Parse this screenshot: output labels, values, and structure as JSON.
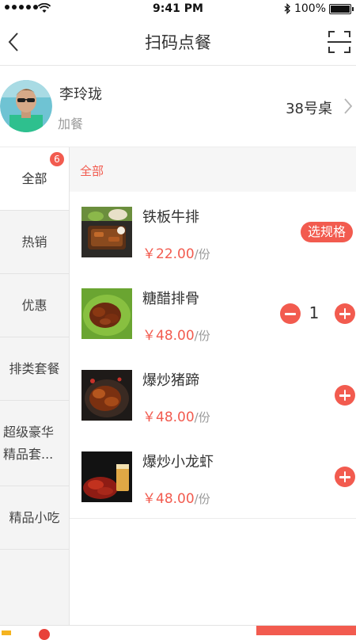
{
  "status": {
    "time": "9:41 PM",
    "battery": "100%"
  },
  "nav": {
    "title": "扫码点餐",
    "back_icon": "chevron-left-icon",
    "scan_icon": "scan-icon"
  },
  "user": {
    "name": "李玲珑",
    "tag": "加餐",
    "table": "38号桌"
  },
  "sidebar": {
    "items": [
      {
        "label": "全部",
        "badge": "6",
        "active": true
      },
      {
        "label": "热销"
      },
      {
        "label": "优惠"
      },
      {
        "label": "排类套餐"
      },
      {
        "label": "超级豪华精品套..."
      },
      {
        "label": "精品小吃"
      }
    ]
  },
  "content": {
    "category_title": "全部",
    "dishes": [
      {
        "name": "铁板牛排",
        "price": "￥22.00",
        "unit": "/份",
        "action": "选规格"
      },
      {
        "name": "糖醋排骨",
        "price": "￥48.00",
        "unit": "/份",
        "quantity": "1"
      },
      {
        "name": "爆炒猪蹄",
        "price": "￥48.00",
        "unit": "/份"
      },
      {
        "name": "爆炒小龙虾",
        "price": "￥48.00",
        "unit": "/份"
      }
    ]
  },
  "colors": {
    "accent": "#f25b4f",
    "sidebar_bg": "#f4f4f4",
    "muted_text": "#999999"
  }
}
